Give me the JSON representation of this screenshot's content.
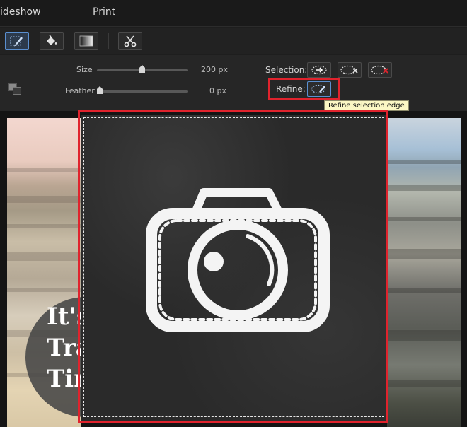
{
  "menu": {
    "slideshow": "ideshow",
    "print": "Print"
  },
  "toolbar": {
    "tools": [
      {
        "icon": "brush-selection-icon",
        "active": true
      },
      {
        "icon": "paint-bucket-icon",
        "active": false
      },
      {
        "icon": "gradient-icon",
        "active": false
      },
      {
        "icon": "scissors-icon",
        "active": false
      }
    ]
  },
  "options": {
    "size_label": "Size",
    "size_value": "200 px",
    "size_fraction": 0.5,
    "feather_label": "Feather",
    "feather_value": "0 px",
    "feather_fraction": 0.0,
    "selection_label": "Selection:",
    "refine_label": "Refine:",
    "tooltip": "Refine selection edge"
  },
  "canvas": {
    "badge_lines": [
      "It's",
      "Tra",
      "Tin"
    ]
  },
  "colors": {
    "highlight": "#e0232d",
    "accent": "#5a8fd0"
  }
}
